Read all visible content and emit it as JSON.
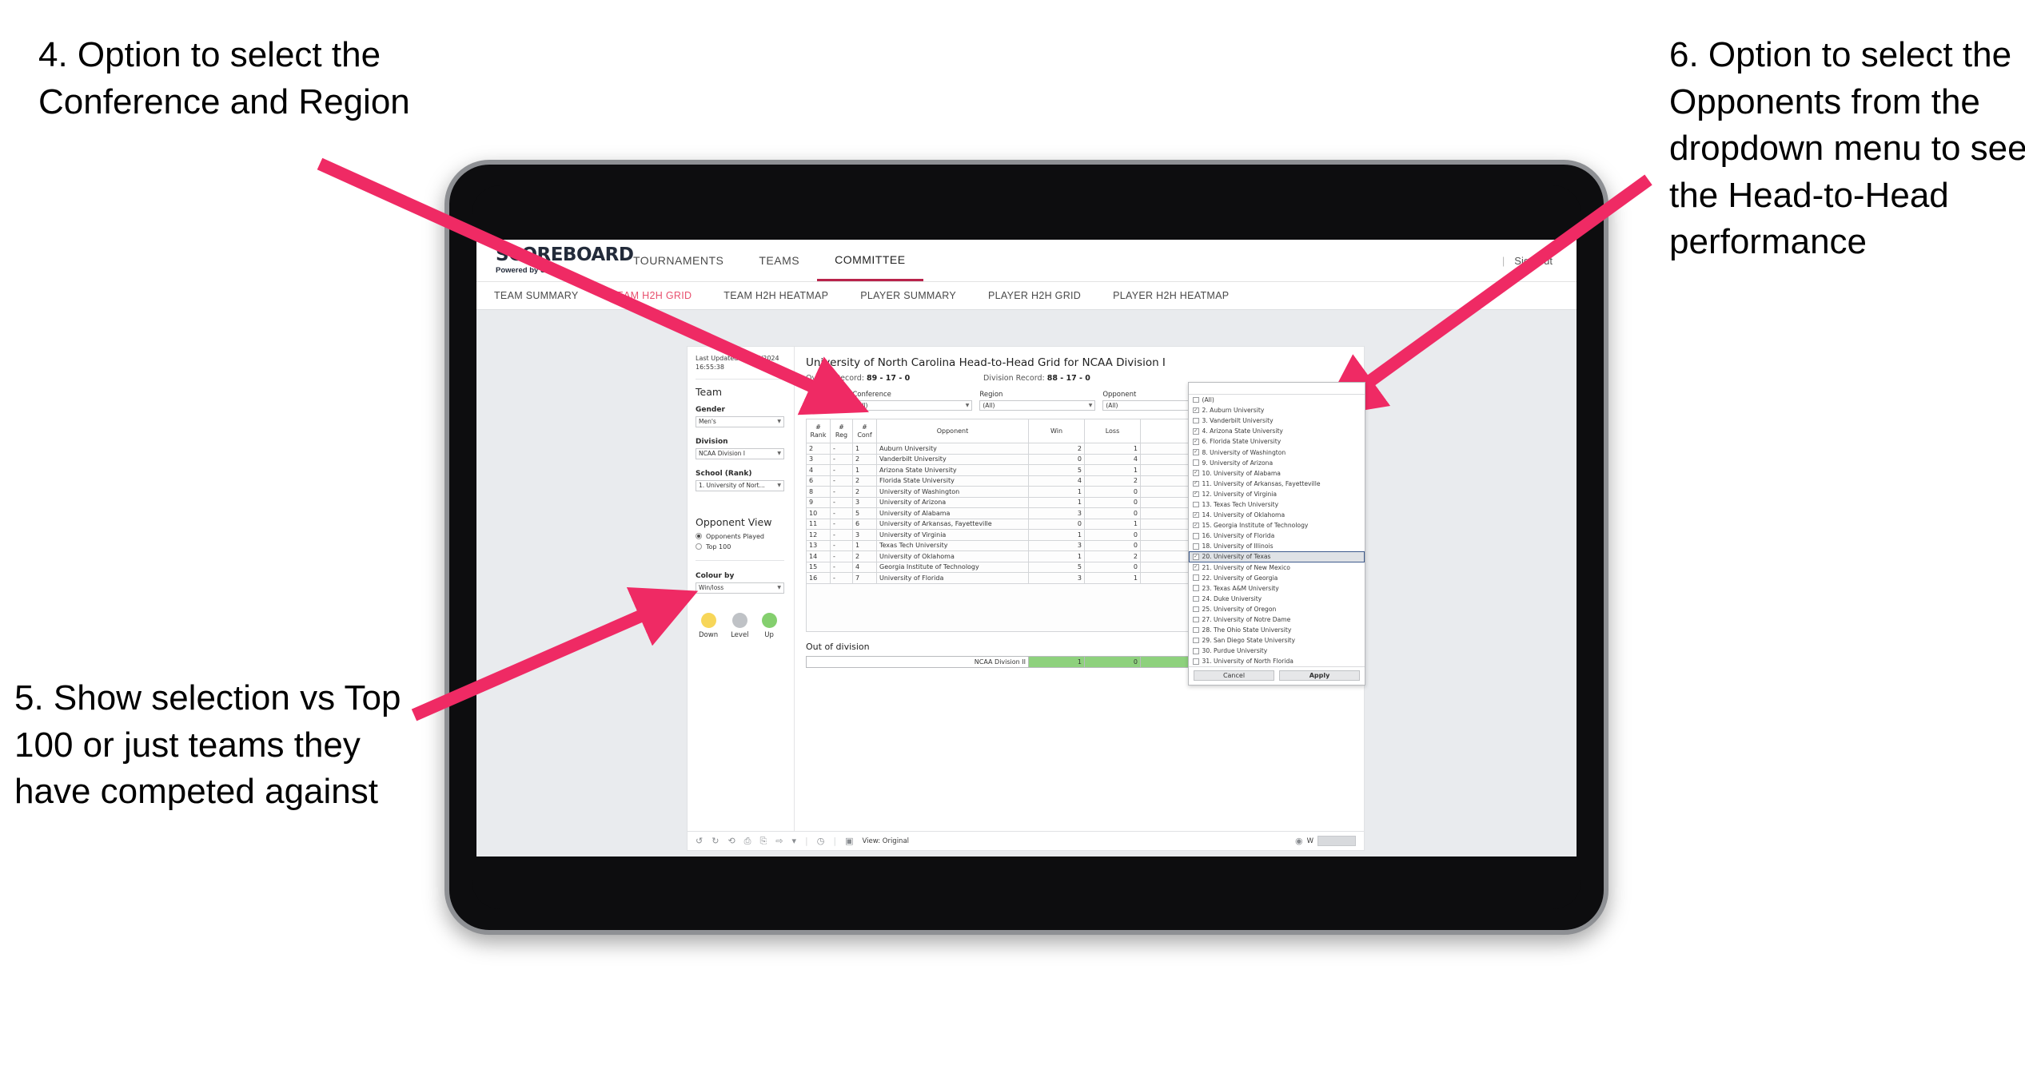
{
  "annotations": [
    {
      "id": "4",
      "text": "4. Option to select the Conference and Region"
    },
    {
      "id": "5",
      "text": "5. Show selection vs Top 100 or just teams they have competed against"
    },
    {
      "id": "6",
      "text": "6. Option to select the Opponents from the dropdown menu to see the Head-to-Head performance"
    }
  ],
  "colors": {
    "arrow": "#ef2a64",
    "accent": "#b9234a",
    "active_subnav": "#e8506e",
    "green": "#8ed17d",
    "yellow": "#f7d659",
    "grey": "#bfc2c6"
  },
  "browser": {
    "logo": {
      "wordmark": "SCOREBOARD",
      "tagline": "Powered by Sfood"
    },
    "topnav": [
      {
        "label": "TOURNAMENTS",
        "active": false
      },
      {
        "label": "TEAMS",
        "active": false
      },
      {
        "label": "COMMITTEE",
        "active": true
      }
    ],
    "signout": {
      "separator": "|",
      "label": "Sign out"
    },
    "subnav": [
      {
        "label": "TEAM SUMMARY",
        "active": false
      },
      {
        "label": "TEAM H2H GRID",
        "active": true
      },
      {
        "label": "TEAM H2H HEATMAP",
        "active": false
      },
      {
        "label": "PLAYER SUMMARY",
        "active": false
      },
      {
        "label": "PLAYER H2H GRID",
        "active": false
      },
      {
        "label": "PLAYER H2H HEATMAP",
        "active": false
      }
    ]
  },
  "filters": {
    "last_updated": "Last Updated: 27/06/2024 16:55:38",
    "team_heading": "Team",
    "gender": {
      "label": "Gender",
      "value": "Men's"
    },
    "division": {
      "label": "Division",
      "value": "NCAA Division I"
    },
    "school": {
      "label": "School (Rank)",
      "value": "1. University of Nort..."
    },
    "opponent_view": {
      "heading": "Opponent View",
      "options": [
        {
          "label": "Opponents Played",
          "selected": true
        },
        {
          "label": "Top 100",
          "selected": false
        }
      ]
    },
    "colour_by": {
      "label": "Colour by",
      "value": "Win/loss"
    },
    "legend": [
      {
        "label": "Down",
        "color": "#f7d659"
      },
      {
        "label": "Level",
        "color": "#bfc2c6"
      },
      {
        "label": "Up",
        "color": "#84cf6e"
      }
    ]
  },
  "viz": {
    "title": "University of North Carolina Head-to-Head Grid for NCAA Division I",
    "overall_record_label": "Overall Record:",
    "overall_record_value": "89 - 17 - 0",
    "division_record_label": "Division Record:",
    "division_record_value": "88 - 17 - 0",
    "opponents_label": "Opponents:",
    "conference": {
      "label": "Conference",
      "value": "(All)"
    },
    "region": {
      "label": "Region",
      "value": "(All)"
    },
    "opponent": {
      "label": "Opponent",
      "value": "(All)"
    },
    "out_of_division_title": "Out of division"
  },
  "chart_data": {
    "type": "table",
    "title": "University of North Carolina Head-to-Head Grid for NCAA Division I",
    "columns": [
      "# Rank",
      "# Reg",
      "# Conf",
      "Opponent",
      "Win",
      "Loss",
      ""
    ],
    "rows": [
      {
        "rank": "2",
        "reg": "-",
        "conf": "1",
        "opponent": "Auburn University",
        "win": "2",
        "loss": "1",
        "color": "green"
      },
      {
        "rank": "3",
        "reg": "-",
        "conf": "2",
        "opponent": "Vanderbilt University",
        "win": "0",
        "loss": "4",
        "color": "yellow"
      },
      {
        "rank": "4",
        "reg": "-",
        "conf": "1",
        "opponent": "Arizona State University",
        "win": "5",
        "loss": "1",
        "color": "green"
      },
      {
        "rank": "6",
        "reg": "-",
        "conf": "2",
        "opponent": "Florida State University",
        "win": "4",
        "loss": "2",
        "color": "green"
      },
      {
        "rank": "8",
        "reg": "-",
        "conf": "2",
        "opponent": "University of Washington",
        "win": "1",
        "loss": "0",
        "color": "green"
      },
      {
        "rank": "9",
        "reg": "-",
        "conf": "3",
        "opponent": "University of Arizona",
        "win": "1",
        "loss": "0",
        "color": "green"
      },
      {
        "rank": "10",
        "reg": "-",
        "conf": "5",
        "opponent": "University of Alabama",
        "win": "3",
        "loss": "0",
        "color": "green"
      },
      {
        "rank": "11",
        "reg": "-",
        "conf": "6",
        "opponent": "University of Arkansas, Fayetteville",
        "win": "0",
        "loss": "1",
        "color": "yellow"
      },
      {
        "rank": "12",
        "reg": "-",
        "conf": "3",
        "opponent": "University of Virginia",
        "win": "1",
        "loss": "0",
        "color": "green"
      },
      {
        "rank": "13",
        "reg": "-",
        "conf": "1",
        "opponent": "Texas Tech University",
        "win": "3",
        "loss": "0",
        "color": "green"
      },
      {
        "rank": "14",
        "reg": "-",
        "conf": "2",
        "opponent": "University of Oklahoma",
        "win": "1",
        "loss": "2",
        "color": "yellow"
      },
      {
        "rank": "15",
        "reg": "-",
        "conf": "4",
        "opponent": "Georgia Institute of Technology",
        "win": "5",
        "loss": "0",
        "color": "green"
      },
      {
        "rank": "16",
        "reg": "-",
        "conf": "7",
        "opponent": "University of Florida",
        "win": "3",
        "loss": "1",
        "color": "green"
      }
    ],
    "out_of_division": [
      {
        "opponent": "NCAA Division II",
        "win": "1",
        "loss": "0",
        "color": "green"
      }
    ]
  },
  "opponent_dropdown": {
    "options": [
      {
        "label": "(All)",
        "checked": false,
        "highlighted": false
      },
      {
        "label": "2. Auburn University",
        "checked": true,
        "highlighted": false
      },
      {
        "label": "3. Vanderbilt University",
        "checked": false,
        "highlighted": false
      },
      {
        "label": "4. Arizona State University",
        "checked": true,
        "highlighted": false
      },
      {
        "label": "6. Florida State University",
        "checked": true,
        "highlighted": false
      },
      {
        "label": "8. University of Washington",
        "checked": true,
        "highlighted": false
      },
      {
        "label": "9. University of Arizona",
        "checked": false,
        "highlighted": false
      },
      {
        "label": "10. University of Alabama",
        "checked": true,
        "highlighted": false
      },
      {
        "label": "11. University of Arkansas, Fayetteville",
        "checked": true,
        "highlighted": false
      },
      {
        "label": "12. University of Virginia",
        "checked": true,
        "highlighted": false
      },
      {
        "label": "13. Texas Tech University",
        "checked": false,
        "highlighted": false
      },
      {
        "label": "14. University of Oklahoma",
        "checked": true,
        "highlighted": false
      },
      {
        "label": "15. Georgia Institute of Technology",
        "checked": true,
        "highlighted": false
      },
      {
        "label": "16. University of Florida",
        "checked": false,
        "highlighted": false
      },
      {
        "label": "18. University of Illinois",
        "checked": false,
        "highlighted": false
      },
      {
        "label": "20. University of Texas",
        "checked": true,
        "highlighted": true
      },
      {
        "label": "21. University of New Mexico",
        "checked": true,
        "highlighted": false
      },
      {
        "label": "22. University of Georgia",
        "checked": false,
        "highlighted": false
      },
      {
        "label": "23. Texas A&M University",
        "checked": false,
        "highlighted": false
      },
      {
        "label": "24. Duke University",
        "checked": false,
        "highlighted": false
      },
      {
        "label": "25. University of Oregon",
        "checked": false,
        "highlighted": false
      },
      {
        "label": "27. University of Notre Dame",
        "checked": false,
        "highlighted": false
      },
      {
        "label": "28. The Ohio State University",
        "checked": false,
        "highlighted": false
      },
      {
        "label": "29. San Diego State University",
        "checked": false,
        "highlighted": false
      },
      {
        "label": "30. Purdue University",
        "checked": false,
        "highlighted": false
      },
      {
        "label": "31. University of North Florida",
        "checked": false,
        "highlighted": false
      }
    ],
    "cancel_label": "Cancel",
    "apply_label": "Apply"
  },
  "toolbar": {
    "icons": [
      "undo-icon",
      "redo-icon",
      "revert-icon",
      "refresh-icon",
      "pause-icon",
      "dropdown-icon",
      "caret-icon",
      "history-icon"
    ],
    "view_label": "View: Original",
    "eye_label": "W"
  }
}
